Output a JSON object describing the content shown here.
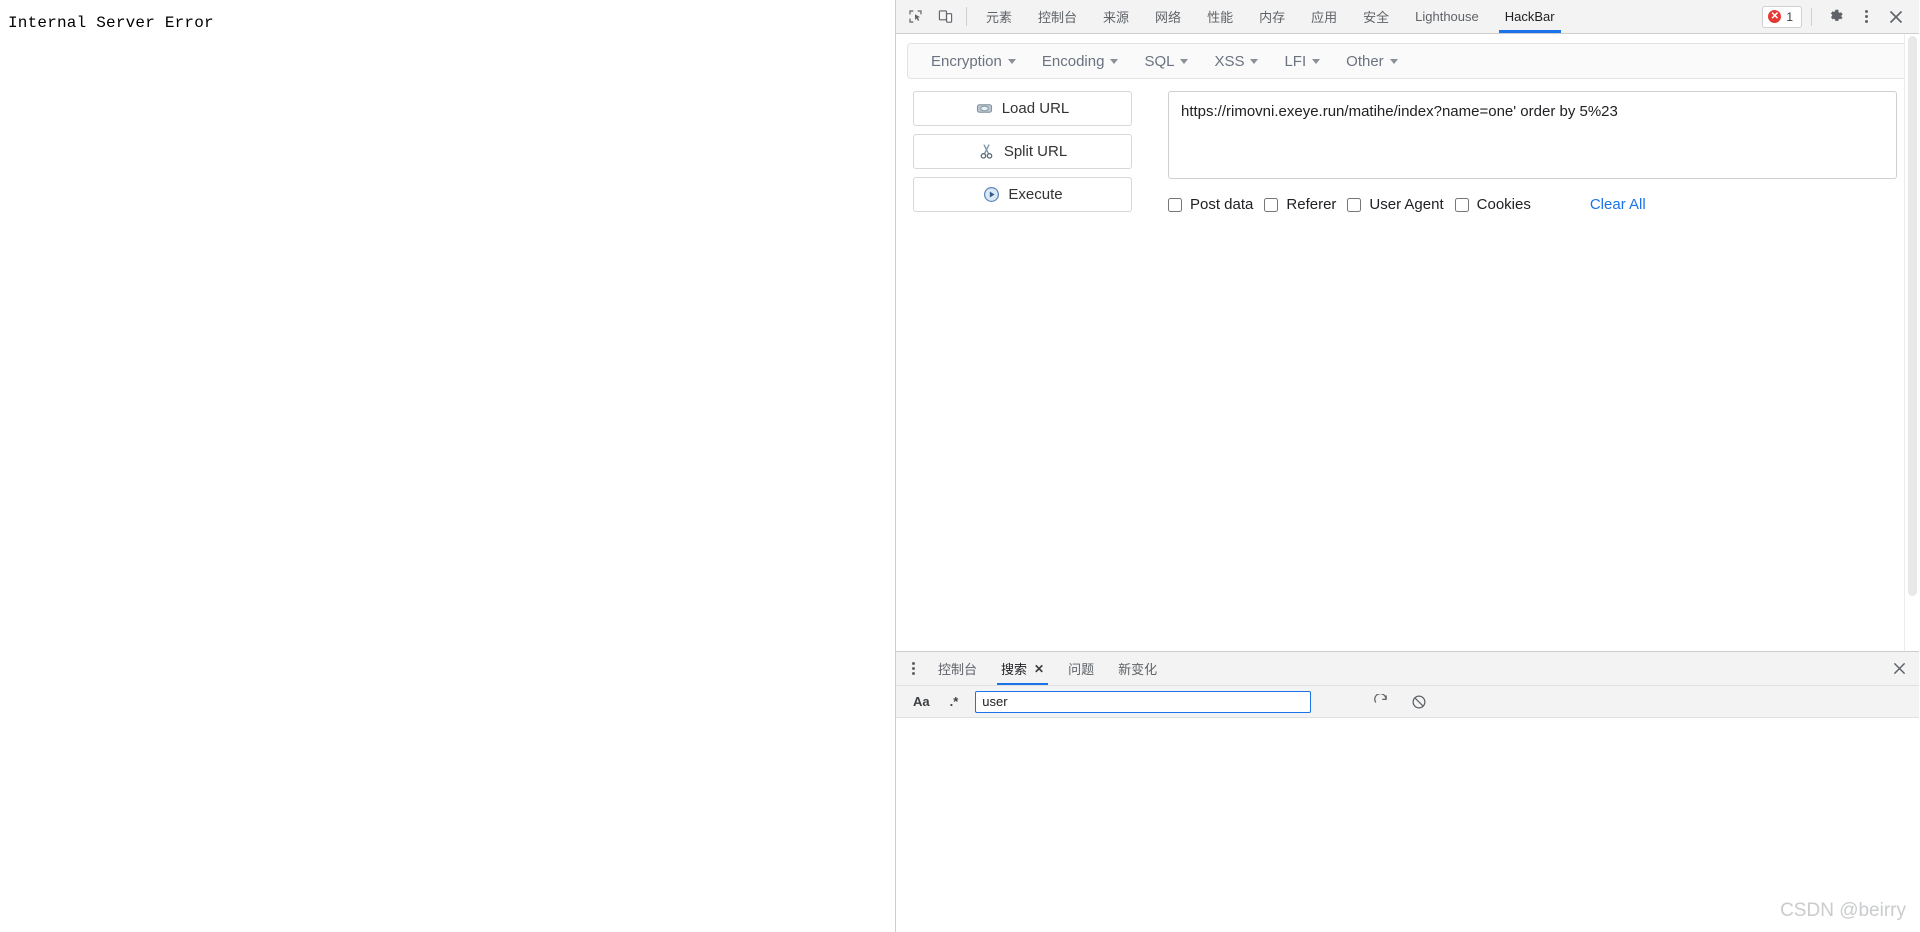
{
  "page": {
    "error_text": "Internal Server Error"
  },
  "devtools": {
    "inspect_icon": "inspect-element-icon",
    "device_icon": "device-toolbar-icon",
    "tabs": [
      {
        "label": "元素",
        "active": false
      },
      {
        "label": "控制台",
        "active": false
      },
      {
        "label": "来源",
        "active": false
      },
      {
        "label": "网络",
        "active": false
      },
      {
        "label": "性能",
        "active": false
      },
      {
        "label": "内存",
        "active": false
      },
      {
        "label": "应用",
        "active": false
      },
      {
        "label": "安全",
        "active": false
      },
      {
        "label": "Lighthouse",
        "active": false
      },
      {
        "label": "HackBar",
        "active": true
      }
    ],
    "error_badge": {
      "icon": "error-circle-icon",
      "count": "1"
    },
    "settings_icon": "gear-icon",
    "more_icon": "more-vertical-icon",
    "close_icon": "close-icon"
  },
  "hackbar": {
    "menus": [
      {
        "label": "Encryption"
      },
      {
        "label": "Encoding"
      },
      {
        "label": "SQL"
      },
      {
        "label": "XSS"
      },
      {
        "label": "LFI"
      },
      {
        "label": "Other"
      }
    ],
    "buttons": [
      {
        "label": "Load URL",
        "icon": "load-url-icon"
      },
      {
        "label": "Split URL",
        "icon": "split-url-scissors-icon"
      },
      {
        "label": "Execute",
        "icon": "execute-play-icon"
      }
    ],
    "url_value": "https://rimovni.exeye.run/matihe/index?name=one' order by 5%23",
    "url_placeholder": "",
    "checkboxes": [
      {
        "label": "Post data",
        "checked": false
      },
      {
        "label": "Referer",
        "checked": false
      },
      {
        "label": "User Agent",
        "checked": false
      },
      {
        "label": "Cookies",
        "checked": false
      }
    ],
    "clear_all_label": "Clear All",
    "clear_all_color": "#1a73e8"
  },
  "drawer": {
    "tabs": [
      {
        "label": "控制台",
        "active": false,
        "closable": false
      },
      {
        "label": "搜索",
        "active": true,
        "closable": true
      },
      {
        "label": "问题",
        "active": false,
        "closable": false
      },
      {
        "label": "新变化",
        "active": false,
        "closable": false
      }
    ],
    "close_icon": "close-icon",
    "search": {
      "match_case_label": "Aa",
      "regex_label": ".*",
      "value": "user",
      "placeholder": "",
      "refresh_icon": "refresh-icon",
      "clear_icon": "clear-no-entry-icon"
    }
  },
  "watermark": {
    "text": "CSDN @beirry"
  },
  "theme": {
    "accent": "#1a73e8",
    "toolbar_bg": "#f3f3f3",
    "error_red": "#e53935",
    "muted_text": "#5f6368"
  }
}
